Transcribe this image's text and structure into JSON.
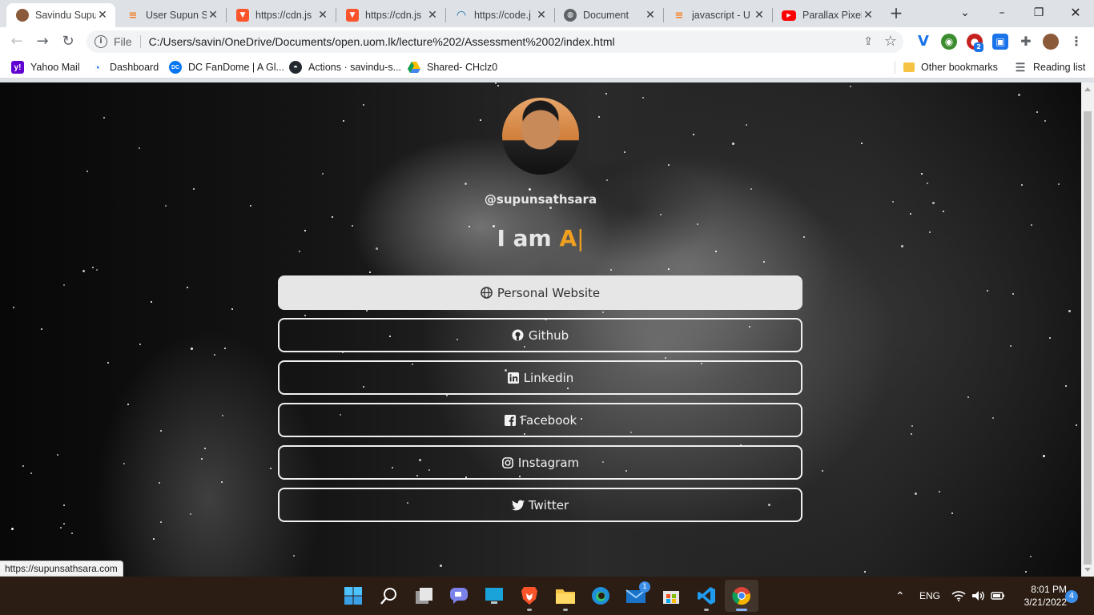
{
  "browser": {
    "tabs": [
      {
        "title": "Savindu Supu",
        "favicon": "avatar-favicon",
        "active": true
      },
      {
        "title": "User Supun S",
        "favicon": "stackoverflow-favicon"
      },
      {
        "title": "https://cdn.js",
        "favicon": "brave-shield-favicon"
      },
      {
        "title": "https://cdn.js",
        "favicon": "brave-shield-favicon"
      },
      {
        "title": "https://code.j",
        "favicon": "jquery-favicon"
      },
      {
        "title": "Document",
        "favicon": "globe-favicon"
      },
      {
        "title": "javascript - U",
        "favicon": "stackoverflow-favicon"
      },
      {
        "title": "Parallax Pixel",
        "favicon": "youtube-favicon"
      }
    ],
    "omnibox": {
      "scheme": "File",
      "url": "C:/Users/savin/OneDrive/Documents/open.uom.lk/lecture%202/Assessment%2002/index.html"
    },
    "bookmarks": [
      {
        "label": "Yahoo Mail",
        "icon": "yahoo-icon"
      },
      {
        "label": "Dashboard",
        "icon": "dashboard-icon"
      },
      {
        "label": "DC FanDome | A Gl...",
        "icon": "dc-icon"
      },
      {
        "label": "Actions · savindu-s...",
        "icon": "github-icon"
      },
      {
        "label": "Shared- CHclz0",
        "icon": "google-drive-icon"
      }
    ],
    "other_bookmarks": "Other bookmarks",
    "reading_list": "Reading list",
    "status_url": "https://supunsathsara.com",
    "extension_badge": "2"
  },
  "page": {
    "handle": "@supunsathsara",
    "typed_prefix": "I am",
    "typed_word": "A",
    "caret": "|",
    "accent_color": "#f0a020",
    "links": [
      {
        "label": "Personal Website",
        "icon": "globe-icon",
        "hovered": true
      },
      {
        "label": "Github",
        "icon": "github-icon"
      },
      {
        "label": "Linkedin",
        "icon": "linkedin-icon"
      },
      {
        "label": "Facebook",
        "icon": "facebook-icon"
      },
      {
        "label": "Instagram",
        "icon": "instagram-icon"
      },
      {
        "label": "Twitter",
        "icon": "twitter-icon"
      }
    ]
  },
  "taskbar": {
    "apps": [
      "windows-start-icon",
      "search-icon",
      "task-view-icon",
      "teams-chat-icon",
      "desktop-icon",
      "brave-icon",
      "file-explorer-icon",
      "edge-icon",
      "mail-icon",
      "store-icon",
      "vscode-icon",
      "chrome-icon"
    ],
    "mail_badge": "1",
    "language": "ENG",
    "time": "8:01 PM",
    "date": "3/21/2022",
    "notifications": "4"
  }
}
